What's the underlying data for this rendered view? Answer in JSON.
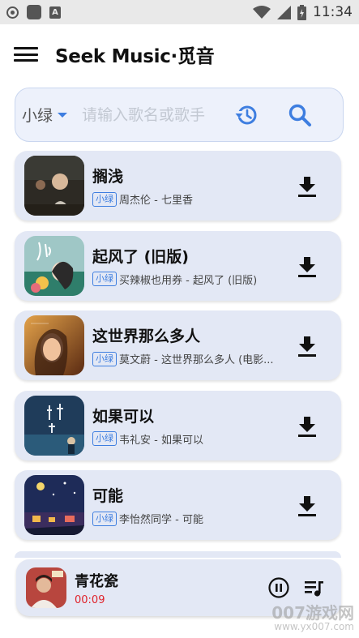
{
  "status_bar": {
    "time": "11:34"
  },
  "app_bar": {
    "title": "Seek Music·觅音"
  },
  "search": {
    "source": "小绿",
    "placeholder": "请输入歌名或歌手"
  },
  "songs": [
    {
      "title": "搁浅",
      "source": "小绿",
      "subtitle": "周杰伦 - 七里香"
    },
    {
      "title": "起风了 (旧版)",
      "source": "小绿",
      "subtitle": "买辣椒也用券 - 起风了 (旧版)"
    },
    {
      "title": "这世界那么多人",
      "source": "小绿",
      "subtitle": "莫文蔚 - 这世界那么多人 (电影..."
    },
    {
      "title": "如果可以",
      "source": "小绿",
      "subtitle": "韦礼安 - 如果可以"
    },
    {
      "title": "可能",
      "source": "小绿",
      "subtitle": "李怡然同学 - 可能"
    }
  ],
  "player": {
    "title": "青花瓷",
    "time": "00:09"
  },
  "watermark": {
    "text": "007游戏网",
    "url": "www.yx007.com"
  },
  "colors": {
    "accent": "#3e7ee0",
    "card_bg": "#e3e8f5",
    "time_red": "#e0232b"
  }
}
